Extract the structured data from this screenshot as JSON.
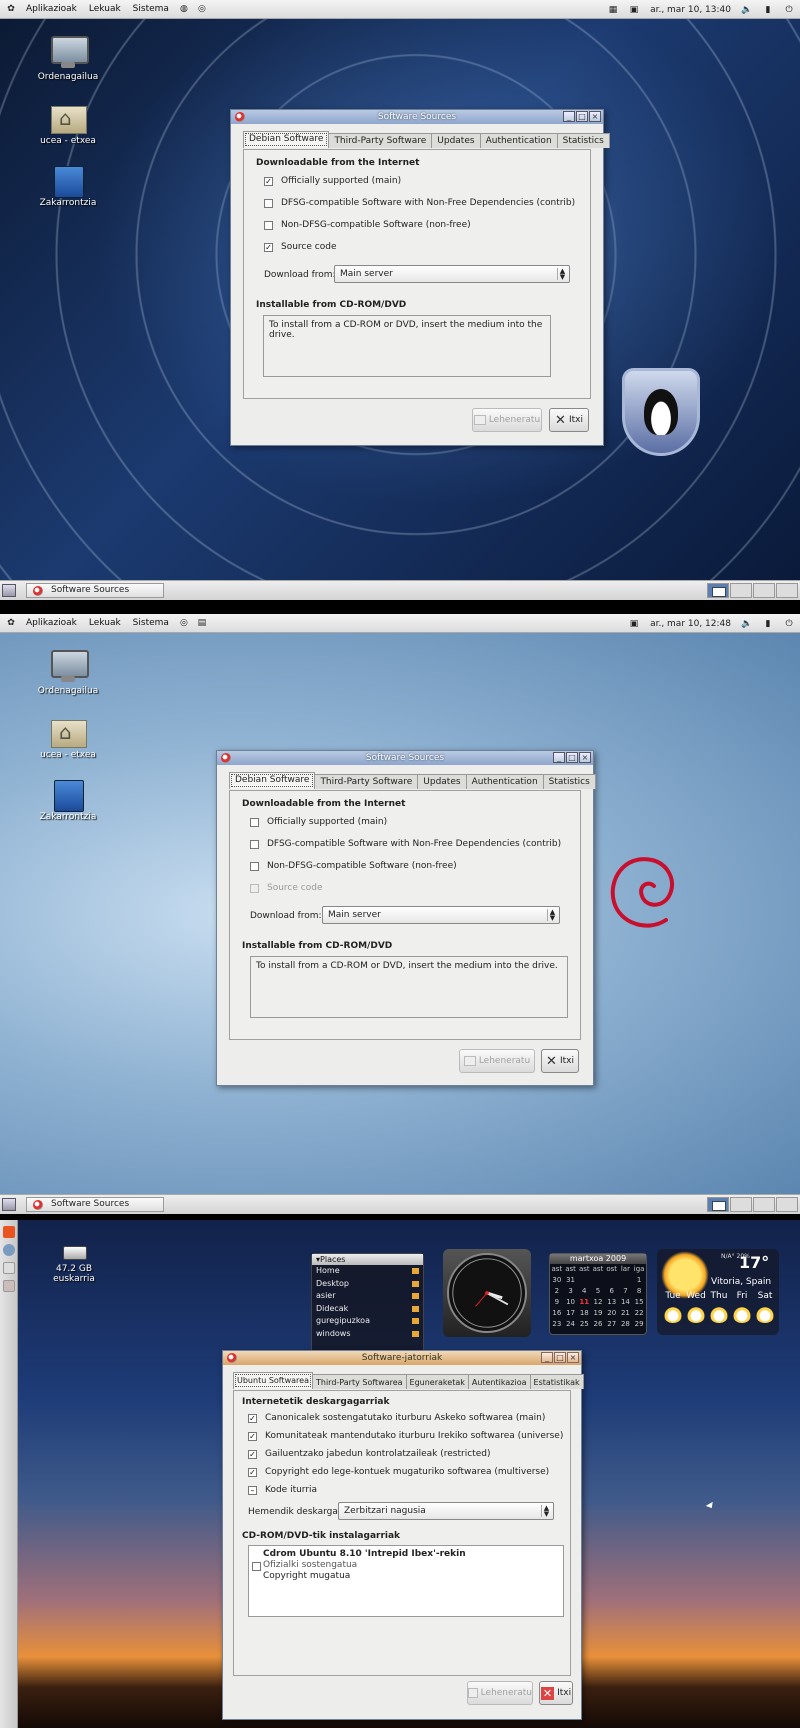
{
  "common": {
    "menus": [
      "Aplikazioak",
      "Lekuak",
      "Sistema"
    ],
    "window_title": "Software Sources",
    "tabs": [
      "Debian Software",
      "Third-Party Software",
      "Updates",
      "Authentication",
      "Statistics"
    ],
    "heading_internet": "Downloadable from the Internet",
    "options": [
      "Officially supported (main)",
      "DFSG-compatible Software with Non-Free Dependencies (contrib)",
      "Non-DFSG-compatible Software (non-free)",
      "Source code"
    ],
    "download_from_label": "Download from:",
    "download_from_value": "Main server",
    "heading_cdrom": "Installable from CD-ROM/DVD",
    "cdrom_hint": "To install from a CD-ROM or DVD, insert the medium into the drive.",
    "reload_label": "Leheneratu",
    "close_label": "Itxi",
    "taskbar_label": "Software Sources",
    "desktop_icons": [
      "Ordenagailua",
      "ucea - etxea",
      "Zakarrontzia"
    ]
  },
  "screen1": {
    "clock": "ar., mar 10, 13:40",
    "checked": [
      true,
      false,
      false,
      true
    ]
  },
  "screen2": {
    "clock": "ar., mar 10, 12:48",
    "checked": [
      false,
      false,
      false,
      false
    ],
    "disabled": [
      false,
      false,
      false,
      true
    ]
  },
  "screen3": {
    "drive_label": "47.2 GB euskarria",
    "window_title": "Software-jatorriak",
    "tabs": [
      "Ubuntu Softwarea",
      "Third-Party Softwarea",
      "Eguneraketak",
      "Autentikazioa",
      "Estatistikak"
    ],
    "heading_internet": "Internetetik deskargagarriak",
    "options": [
      "Canonicalek sostengatutako iturburu Askeko softwarea (main)",
      "Komunitateak mantendutako iturburu Irekiko softwarea (universe)",
      "Gailuentzako jabedun kontrolatzaileak (restricted)",
      "Copyright edo lege-kontuek mugaturiko softwarea (multiverse)",
      "Kode iturria"
    ],
    "checked": [
      true,
      true,
      true,
      true,
      false
    ],
    "download_from_label": "Hemendik deskargatu:",
    "download_from_value": "Zerbitzari nagusia",
    "heading_cdrom": "CD-ROM/DVD-tik instalagarriak",
    "cdrom_entry_title": "Cdrom Ubuntu 8.10 'Intrepid Ibex'-rekin",
    "cdrom_entry_line1": "Ofizialki sostengatua",
    "cdrom_entry_line2": "Copyright mugatua",
    "reload_label": "Leheneratu",
    "close_label": "Itxi",
    "places_header": "▾Places",
    "places": [
      "Home",
      "Desktop",
      "asier",
      "Didecak",
      "guregipuzkoa",
      "windows"
    ],
    "calendar_title": "martxoa 2009",
    "calendar_days": [
      "ast",
      "ast",
      "ast",
      "ast",
      "ost",
      "lar",
      "iga"
    ],
    "calendar_cells": [
      "30",
      "31",
      "",
      "",
      "",
      "",
      "1",
      "2",
      "3",
      "4",
      "5",
      "6",
      "7",
      "8",
      "9",
      "10",
      "11",
      "12",
      "13",
      "14",
      "15",
      "16",
      "17",
      "18",
      "19",
      "20",
      "21",
      "22",
      "23",
      "24",
      "25",
      "26",
      "27",
      "28",
      "29"
    ],
    "weather_temp": "17°",
    "weather_location": "Vitoria, Spain",
    "weather_small": "N/A° 20%",
    "weather_days": [
      "Tue",
      "Wed",
      "Thu",
      "Fri",
      "Sat"
    ]
  }
}
